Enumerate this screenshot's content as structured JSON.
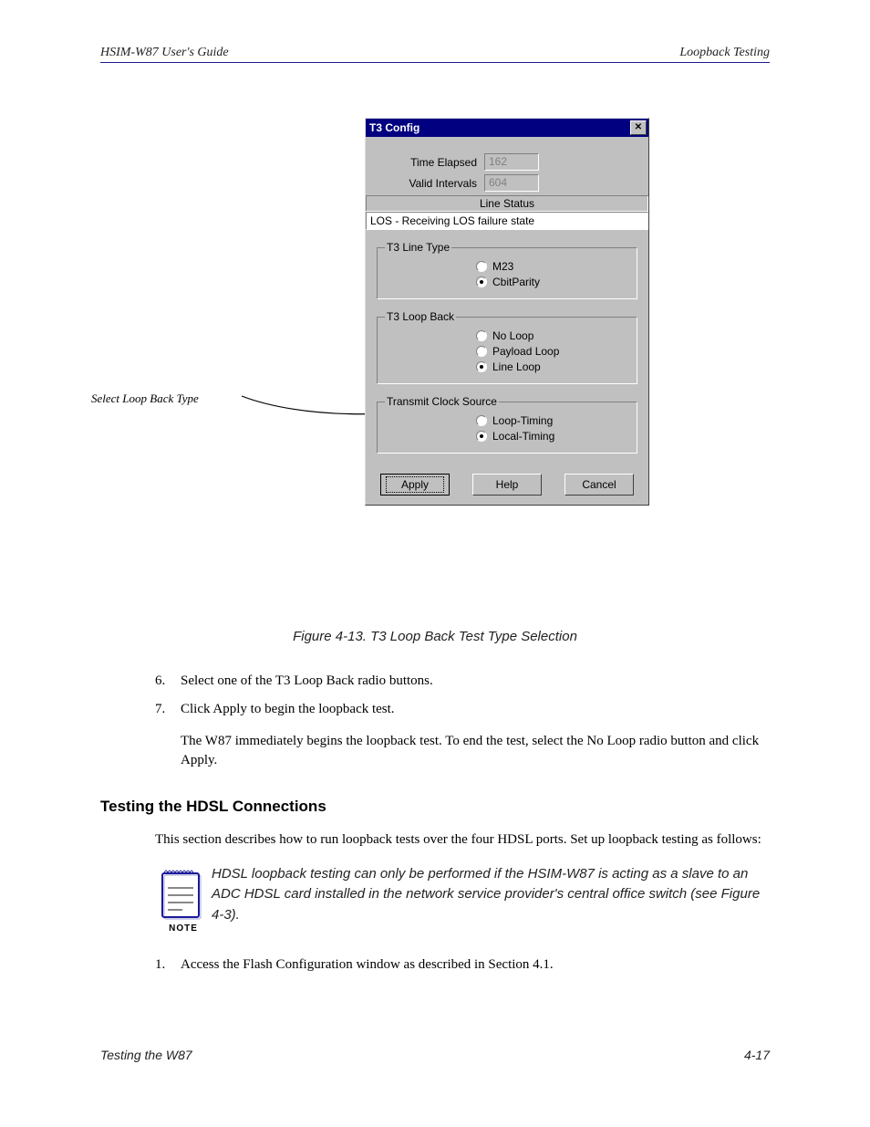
{
  "header": {
    "left": "HSIM-W87 User's Guide",
    "right": "Loopback Testing"
  },
  "annotation_label": "Select Loop Back Type",
  "dialog": {
    "title": "T3 Config",
    "time_elapsed_label": "Time Elapsed",
    "time_elapsed_value": "162",
    "valid_intervals_label": "Valid Intervals",
    "valid_intervals_value": "604",
    "line_status_header": "Line Status",
    "line_status_value": "LOS - Receiving LOS failure state",
    "group_line_type": {
      "legend": "T3 Line Type",
      "options": [
        "M23",
        "CbitParity"
      ],
      "selected": 1
    },
    "group_loop_back": {
      "legend": "T3 Loop Back",
      "options": [
        "No Loop",
        "Payload Loop",
        "Line Loop"
      ],
      "selected": 2
    },
    "group_clock": {
      "legend": "Transmit Clock Source",
      "options": [
        "Loop-Timing",
        "Local-Timing"
      ],
      "selected": 1
    },
    "apply_btn": "Apply",
    "help_btn": "Help",
    "cancel_btn": "Cancel"
  },
  "figure_caption": "Figure 4-13. T3 Loop Back Test Type Selection",
  "step6_num": "6.",
  "step6_text": "Select one of the T3 Loop Back radio buttons.",
  "step7_num": "7.",
  "step7_text": "Click Apply to begin the loopback test.",
  "para_end": "The W87 immediately begins the loopback test. To end the test, select the No Loop radio button and click Apply.",
  "sect_title": "Testing the HDSL Connections",
  "sect_intro": "This section describes how to run loopback tests over the four HDSL ports. Set up loopback testing as follows:",
  "note_text": "HDSL loopback testing can only be performed if the HSIM-W87 is acting as a slave to an ADC HDSL card installed in the network service provider's central office switch (see Figure 4-3).",
  "note_label": "NOTE",
  "step1_num": "1.",
  "step1_text": "Access the Flash Configuration window as described in Section 4.1.",
  "footer": {
    "left": "Testing the W87",
    "right": "4-17"
  }
}
